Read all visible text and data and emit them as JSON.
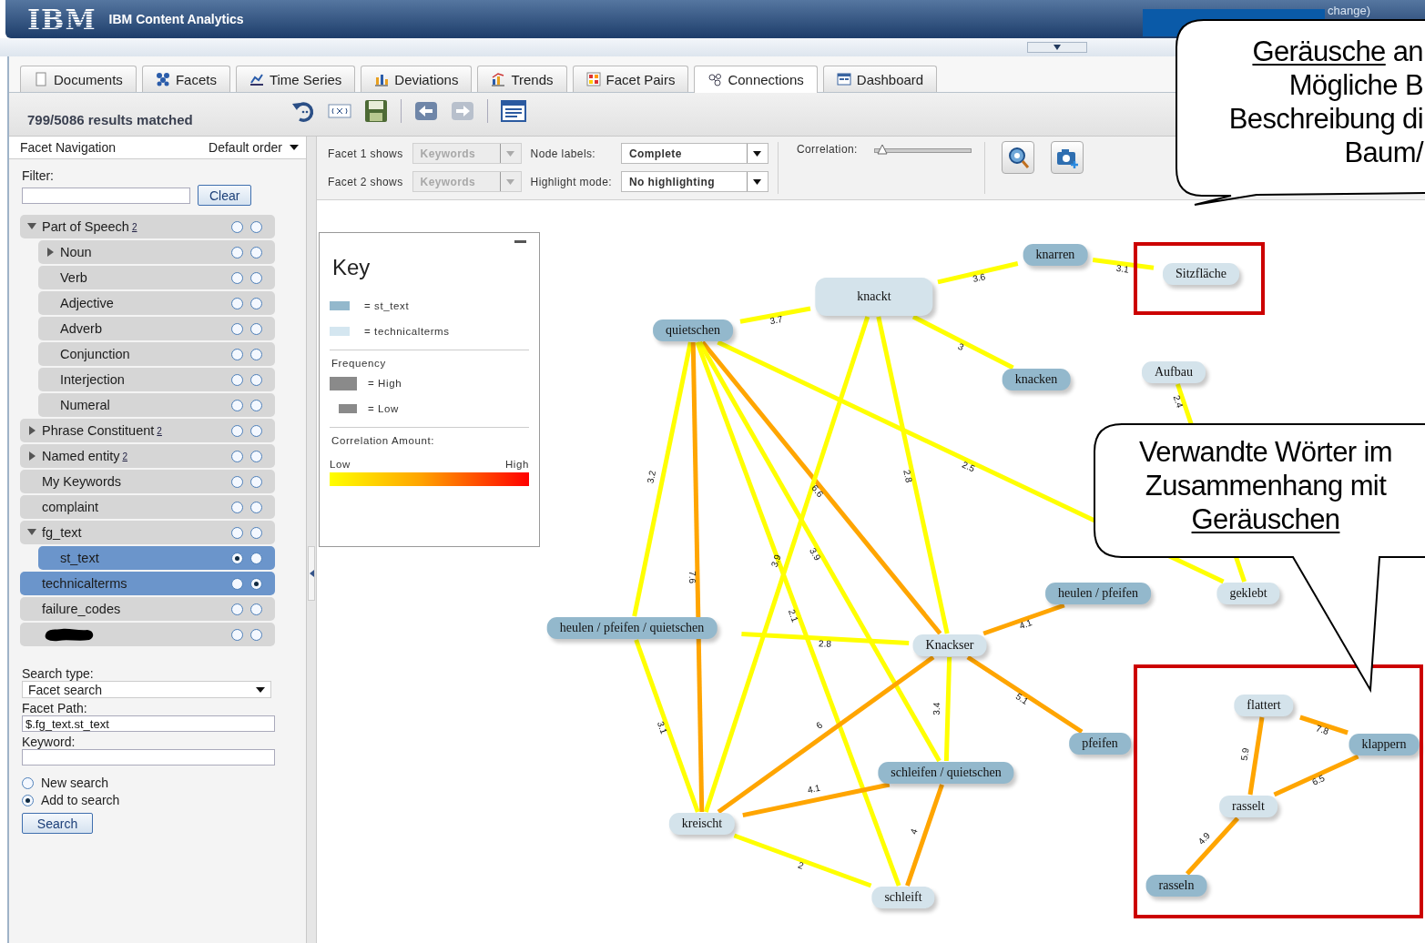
{
  "header": {
    "logo": "IBM",
    "title": "IBM Content Analytics",
    "user_link": "change)"
  },
  "tabs": [
    {
      "label": "Documents",
      "selected": false
    },
    {
      "label": "Facets",
      "selected": false
    },
    {
      "label": "Time Series",
      "selected": false
    },
    {
      "label": "Deviations",
      "selected": false
    },
    {
      "label": "Trends",
      "selected": false
    },
    {
      "label": "Facet Pairs",
      "selected": false
    },
    {
      "label": "Connections",
      "selected": true
    },
    {
      "label": "Dashboard",
      "selected": false
    }
  ],
  "toolbar": {
    "results": "799/5086 results matched"
  },
  "facet_navigation": {
    "title": "Facet Navigation",
    "sort": "Default order",
    "filter_label": "Filter:",
    "clear_button": "Clear",
    "facets": [
      {
        "label": "Part of Speech",
        "help": "2",
        "kind": "group",
        "expanded": true,
        "selected": false,
        "facet1": false,
        "facet2": false,
        "children": [
          {
            "label": "Noun",
            "kind": "group",
            "expanded": false,
            "selected": false,
            "facet1": false,
            "facet2": false
          },
          {
            "label": "Verb",
            "kind": "leaf",
            "selected": false,
            "facet1": false,
            "facet2": false
          },
          {
            "label": "Adjective",
            "kind": "leaf",
            "selected": false,
            "facet1": false,
            "facet2": false
          },
          {
            "label": "Adverb",
            "kind": "leaf",
            "selected": false,
            "facet1": false,
            "facet2": false
          },
          {
            "label": "Conjunction",
            "kind": "leaf",
            "selected": false,
            "facet1": false,
            "facet2": false
          },
          {
            "label": "Interjection",
            "kind": "leaf",
            "selected": false,
            "facet1": false,
            "facet2": false
          },
          {
            "label": "Numeral",
            "kind": "leaf",
            "selected": false,
            "facet1": false,
            "facet2": false
          }
        ]
      },
      {
        "label": "Phrase Constituent",
        "help": "2",
        "kind": "group",
        "expanded": false,
        "selected": false,
        "facet1": false,
        "facet2": false
      },
      {
        "label": "Named entity",
        "help": "2",
        "kind": "group",
        "expanded": false,
        "selected": false,
        "facet1": false,
        "facet2": false
      },
      {
        "label": "My Keywords",
        "kind": "leaf",
        "selected": false,
        "facet1": false,
        "facet2": false
      },
      {
        "label": "complaint",
        "kind": "leaf",
        "selected": false,
        "facet1": false,
        "facet2": false
      },
      {
        "label": "fg_text",
        "kind": "group",
        "expanded": true,
        "selected": false,
        "facet1": false,
        "facet2": false,
        "children": [
          {
            "label": "st_text",
            "kind": "leaf",
            "selected": true,
            "facet1": true,
            "facet2": false
          }
        ]
      },
      {
        "label": "technicalterms",
        "kind": "leaf",
        "selected": true,
        "facet1": false,
        "facet2": true
      },
      {
        "label": "failure_codes",
        "kind": "leaf",
        "selected": false,
        "facet1": false,
        "facet2": false
      },
      {
        "kind": "redacted",
        "selected": false,
        "facet1": false,
        "facet2": false
      }
    ]
  },
  "search": {
    "type_label": "Search type:",
    "type": "Facet search",
    "path_label": "Facet Path:",
    "path": "$.fg_text.st_text",
    "keyword_label": "Keyword:",
    "options": [
      {
        "label": "New search",
        "selected": false
      },
      {
        "label": "Add to search",
        "selected": true
      }
    ],
    "button": "Search"
  },
  "graph_controls": {
    "dropdowns": [
      {
        "label": "Facet 1 shows",
        "value": "Keywords",
        "disabled": true
      },
      {
        "label": "Node labels:",
        "value": "Complete",
        "disabled": false
      },
      {
        "label": "Facet 2 shows",
        "value": "Keywords",
        "disabled": true
      },
      {
        "label": "Highlight mode:",
        "value": "No highlighting",
        "disabled": false
      }
    ],
    "correlation_label": "Correlation:",
    "correlation": {
      "level": 0.08
    }
  },
  "key": {
    "title": "Key",
    "facets": [
      {
        "label": "= st_text",
        "kind": "st_text"
      },
      {
        "label": "= technicalterms",
        "kind": "technicalterms"
      }
    ],
    "frequency_title": "Frequency",
    "frequency": [
      {
        "label": "= High",
        "kind": "high"
      },
      {
        "label": "= Low",
        "kind": "low"
      }
    ],
    "correlation_title": "Correlation Amount:",
    "low": "Low",
    "high": "High"
  },
  "graph": {
    "nodes": [
      {
        "label": "knarren",
        "kind": "st_text",
        "high_frequency": false
      },
      {
        "label": "Sitzfläche",
        "kind": "technicalterms",
        "high_frequency": false
      },
      {
        "label": "knackt",
        "kind": "technicalterms",
        "high_frequency": true
      },
      {
        "label": "quietschen",
        "kind": "st_text",
        "high_frequency": false
      },
      {
        "label": "knacken",
        "kind": "st_text",
        "high_frequency": false
      },
      {
        "label": "Aufbau",
        "kind": "technicalterms",
        "high_frequency": false
      },
      {
        "label": "heulen / pfeifen",
        "kind": "st_text",
        "high_frequency": false
      },
      {
        "label": "geklebt",
        "kind": "technicalterms",
        "high_frequency": false
      },
      {
        "label": "heulen / pfeifen / quietschen",
        "kind": "st_text",
        "high_frequency": false
      },
      {
        "label": "Knackser",
        "kind": "technicalterms",
        "high_frequency": false
      },
      {
        "label": "pfeifen",
        "kind": "st_text",
        "high_frequency": false
      },
      {
        "label": "schleifen / quietschen",
        "kind": "st_text",
        "high_frequency": false
      },
      {
        "label": "kreischt",
        "kind": "technicalterms",
        "high_frequency": false
      },
      {
        "label": "schleift",
        "kind": "technicalterms",
        "high_frequency": false
      },
      {
        "label": "flattert",
        "kind": "technicalterms",
        "high_frequency": false
      },
      {
        "label": "klappern",
        "kind": "st_text",
        "high_frequency": false
      },
      {
        "label": "rasselt",
        "kind": "technicalterms",
        "high_frequency": false
      },
      {
        "label": "rasseln",
        "kind": "st_text",
        "high_frequency": false
      }
    ],
    "edges": [
      {
        "label": "3.7",
        "color": "#ffff00"
      },
      {
        "label": "3.6",
        "color": "#ffff00"
      },
      {
        "label": "3.1",
        "color": "#ffff00"
      },
      {
        "label": "3",
        "color": "#ffff00"
      },
      {
        "label": "3.2",
        "color": "#ffff00"
      },
      {
        "label": "7.6",
        "color": "#ffa500"
      },
      {
        "label": "6.6",
        "color": "#ffa500"
      },
      {
        "label": "2.1",
        "color": "#ffff00"
      },
      {
        "label": "3.9",
        "color": "#ffff00"
      },
      {
        "label": "2.5",
        "color": "#ffff00"
      },
      {
        "label": "3.9",
        "color": "#ffff00"
      },
      {
        "label": "2.8",
        "color": "#ffff00"
      },
      {
        "label": "2.8",
        "color": "#ffff00"
      },
      {
        "label": "3.1",
        "color": "#ffff00"
      },
      {
        "label": "4.1",
        "color": "#ffa500"
      },
      {
        "label": "5.1",
        "color": "#ffa500"
      },
      {
        "label": "6",
        "color": "#ffa500"
      },
      {
        "label": "3.4",
        "color": "#ffff00"
      },
      {
        "label": "4.1",
        "color": "#ffa500"
      },
      {
        "label": "4",
        "color": "#ffa500"
      },
      {
        "label": "2",
        "color": "#ffff00"
      },
      {
        "label": "2.4",
        "color": "#ffff00"
      },
      {
        "label": "7.8",
        "color": "#ffa500"
      },
      {
        "label": "5.9",
        "color": "#ffa500"
      },
      {
        "label": "6.5",
        "color": "#ffa500"
      },
      {
        "label": "4.9",
        "color": "#ffa500"
      }
    ]
  },
  "annotations": [
    {
      "lines": [
        [
          {
            "text": "Geräusche",
            "underline": true
          },
          {
            "text": " an",
            "underline": false
          }
        ],
        [
          {
            "text": "Mögliche B",
            "underline": false
          }
        ],
        [
          {
            "text": "Beschreibung di",
            "underline": false
          }
        ],
        [
          {
            "text": "Baum/",
            "underline": false
          }
        ]
      ]
    },
    {
      "lines": [
        [
          {
            "text": "Verwandte Wörter im",
            "underline": false
          }
        ],
        [
          {
            "text": "Zusammenhang mit",
            "underline": false
          }
        ],
        [
          {
            "text": "Geräuschen",
            "underline": true
          }
        ]
      ]
    }
  ]
}
